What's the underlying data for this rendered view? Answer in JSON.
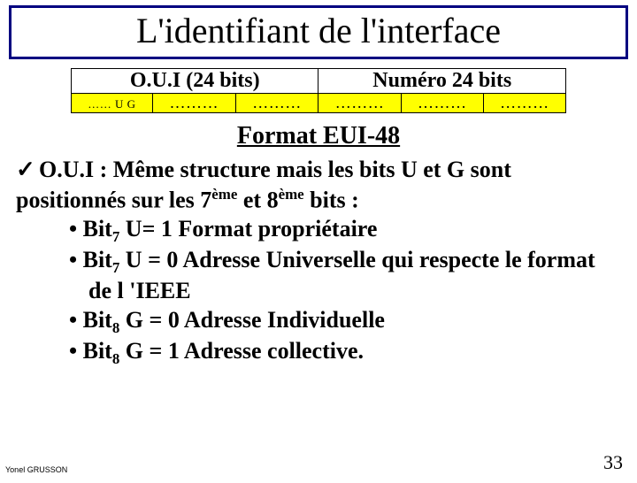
{
  "title": "L'identifiant de l'interface",
  "table": {
    "header_left": "O.U.I (24 bits)",
    "header_right": "Numéro 24 bits",
    "byte1_dots": "……",
    "byte1_ug": "U G",
    "byte2": "………",
    "byte3": "………",
    "byte4": "………",
    "byte5": "………",
    "byte6": "………"
  },
  "format_title": "Format EUI-48",
  "check_mark": "✓",
  "oui_prefix": "O.U.I",
  "oui_text1": " : Même structure mais les bits U et G sont positionnés sur les 7",
  "oui_sup1": "ème",
  "oui_text2": " et 8",
  "oui_sup2": "ème",
  "oui_text3": " bits :",
  "bullets": {
    "b1_a": "Bit",
    "b1_sub": "7",
    "b1_b": " U= 1 Format propriétaire",
    "b2_a": "Bit",
    "b2_sub": "7",
    "b2_b": " U = 0 Adresse Universelle qui respecte le format de l 'IEEE",
    "b3_a": "Bit",
    "b3_sub": "8",
    "b3_b": " G = 0 Adresse Individuelle",
    "b4_a": "Bit",
    "b4_sub": "8",
    "b4_b": " G = 1 Adresse collective."
  },
  "footer_author": "Yonel GRUSSON",
  "page_number": "33"
}
